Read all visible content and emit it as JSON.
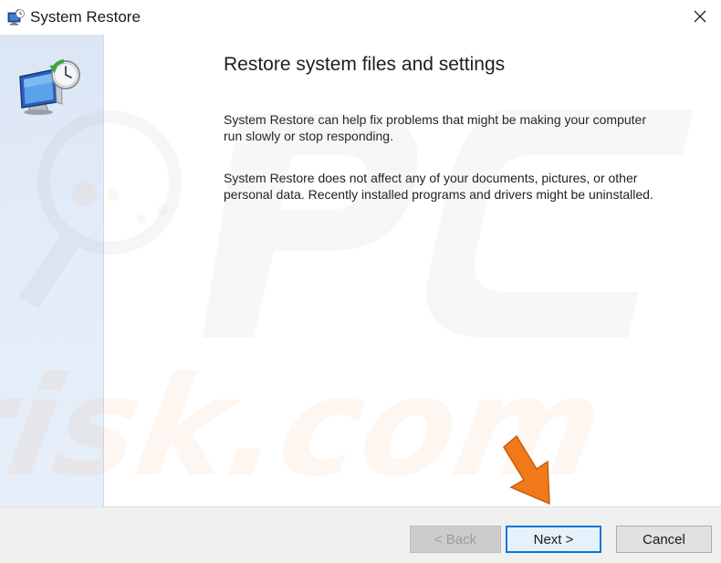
{
  "window": {
    "title": "System Restore",
    "close_glyph": "✕"
  },
  "icons": {
    "title_icon": "system-restore-icon",
    "sidebar_icon": "system-restore-monitor-clock-icon",
    "close_icon": "close-icon"
  },
  "content": {
    "heading": "Restore system files and settings",
    "paragraph1": "System Restore can help fix problems that might be making your computer run slowly or stop responding.",
    "paragraph2": "System Restore does not affect any of your documents, pictures, or other personal data. Recently installed programs and drivers might be uninstalled."
  },
  "buttons": {
    "back_label": "< Back",
    "back_enabled": false,
    "next_label": "Next >",
    "next_default": true,
    "cancel_label": "Cancel"
  },
  "watermark": {
    "text": "PC risk.com"
  },
  "colors": {
    "accent": "#0078d7",
    "sidebar": "#dde8f6",
    "footer": "#f0f0f0",
    "arrow": "#f07a1a"
  }
}
